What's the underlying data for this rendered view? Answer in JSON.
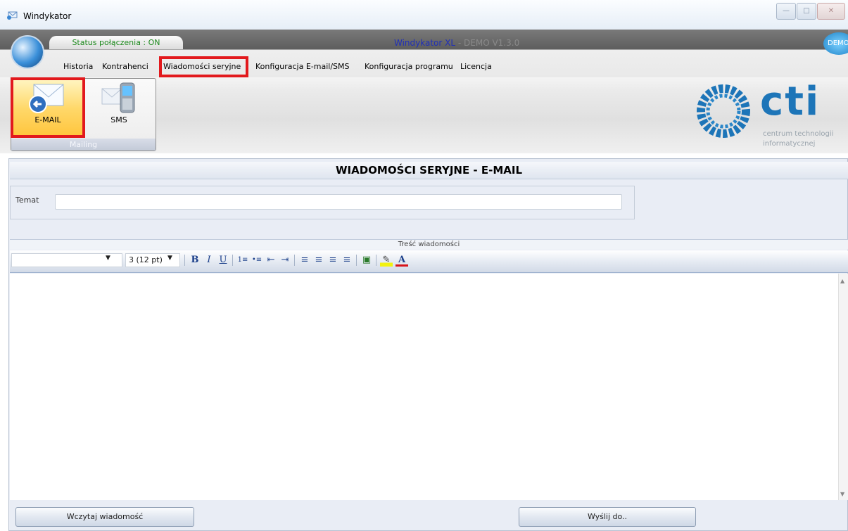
{
  "window": {
    "title": "Windykator",
    "controls": {
      "minimize": "—",
      "maximize": "□",
      "close": "✕"
    }
  },
  "header": {
    "status": "Status połączenia : ON",
    "app_name": "Windykator XL",
    "app_version": "- DEMO V1.3.0",
    "badge": "DEMO"
  },
  "menu": {
    "items": [
      {
        "label": "Historia"
      },
      {
        "label": "Kontrahenci"
      },
      {
        "label": "Wiadomości seryjne",
        "active": true
      },
      {
        "label": "Konfiguracja E-mail/SMS"
      },
      {
        "label": "Konfiguracja programu"
      },
      {
        "label": "Licencja"
      }
    ]
  },
  "toolbar": {
    "group_label": "Mailing",
    "buttons": [
      {
        "label": "E-MAIL",
        "icon": "email-reply-icon",
        "active": true
      },
      {
        "label": "SMS",
        "icon": "mobile-phone-icon"
      }
    ]
  },
  "logo": {
    "text": "cti",
    "sub1": "centrum technologii",
    "sub2": "informatycznej",
    "color": "#1d75b8"
  },
  "page": {
    "title": "WIADOMOŚCI SERYJNE - E-MAIL",
    "subject_label": "Temat",
    "subject_value": "",
    "body_header": "Treść wiadomości"
  },
  "editor": {
    "font_value": "",
    "size_value": "3 (12 pt)",
    "buttons": {
      "bold": "B",
      "italic": "I",
      "underline": "U",
      "ordered_list": "1≡",
      "unordered_list": "•≡",
      "outdent": "⇤",
      "indent": "⇥",
      "align_left": "≡",
      "align_center": "≡",
      "align_right": "≡",
      "justify": "≡",
      "image": "▣",
      "highlight": "✎",
      "font_color": "A"
    },
    "content": ""
  },
  "actions": {
    "load": "Wczytaj wiadomość",
    "send": "Wyślij do.."
  },
  "colors": {
    "highlight_border": "#e2191d",
    "accent_blue": "#1f2fb8"
  }
}
